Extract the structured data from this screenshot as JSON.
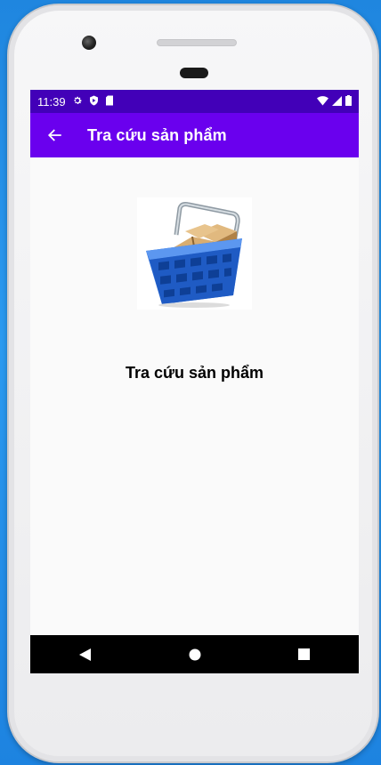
{
  "status_bar": {
    "time": "11:39",
    "left_icons": [
      "settings-icon",
      "shield-icon",
      "sd-card-icon"
    ],
    "right_icons": [
      "wifi-icon",
      "signal-icon",
      "battery-icon"
    ]
  },
  "app_bar": {
    "back_icon": "arrow-left-icon",
    "title": "Tra cứu sản phẩm"
  },
  "main": {
    "image": "shopping-basket-boxes",
    "label": "Tra cứu sản phẩm"
  },
  "nav_bar": {
    "buttons": [
      "back-triangle-icon",
      "home-circle-icon",
      "recents-square-icon"
    ]
  },
  "colors": {
    "status_bar": "#4200b8",
    "app_bar": "#6a00ee",
    "screen_bg": "#fafafa",
    "nav_bar": "#000000"
  }
}
